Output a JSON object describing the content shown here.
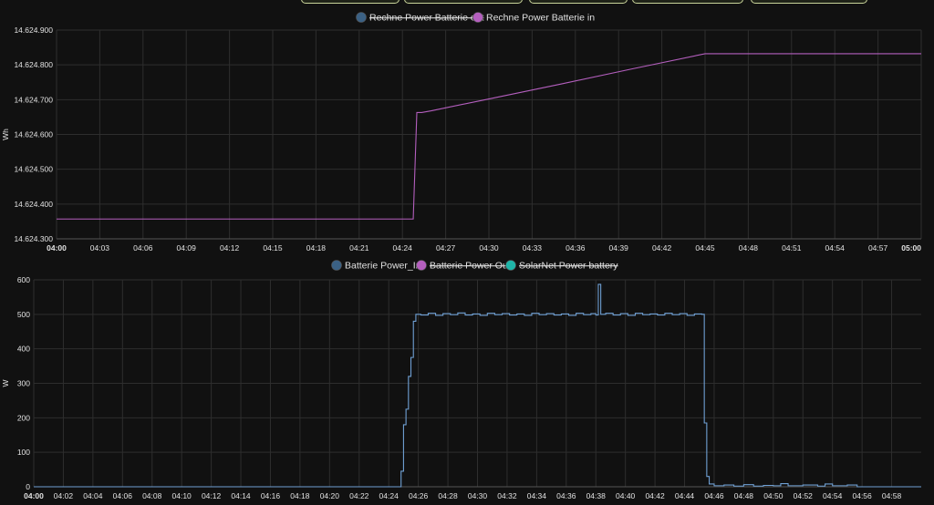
{
  "top_buttons": [
    "",
    "",
    "",
    "",
    ""
  ],
  "chart_data": [
    {
      "type": "line",
      "ylabel": "Wh",
      "ylim": [
        14624.3,
        14624.9
      ],
      "y_ticks": [
        {
          "value": 14624.9,
          "label": "14.624.900"
        },
        {
          "value": 14624.8,
          "label": "14.624.800"
        },
        {
          "value": 14624.7,
          "label": "14.624.700"
        },
        {
          "value": 14624.6,
          "label": "14.624.600"
        },
        {
          "value": 14624.5,
          "label": "14.624.500"
        },
        {
          "value": 14624.4,
          "label": "14.624.400"
        },
        {
          "value": 14624.3,
          "label": "14.624.300"
        }
      ],
      "x_range": [
        "04:00",
        "05:00"
      ],
      "x_ticks": [
        {
          "value": "04:00",
          "label": "04:00",
          "bold": true
        },
        {
          "value": "04:03",
          "label": "04:03"
        },
        {
          "value": "04:06",
          "label": "04:06"
        },
        {
          "value": "04:09",
          "label": "04:09"
        },
        {
          "value": "04:12",
          "label": "04:12"
        },
        {
          "value": "04:15",
          "label": "04:15"
        },
        {
          "value": "04:18",
          "label": "04:18"
        },
        {
          "value": "04:21",
          "label": "04:21"
        },
        {
          "value": "04:24",
          "label": "04:24"
        },
        {
          "value": "04:27",
          "label": "04:27"
        },
        {
          "value": "04:30",
          "label": "04:30"
        },
        {
          "value": "04:33",
          "label": "04:33"
        },
        {
          "value": "04:36",
          "label": "04:36"
        },
        {
          "value": "04:39",
          "label": "04:39"
        },
        {
          "value": "04:42",
          "label": "04:42"
        },
        {
          "value": "04:45",
          "label": "04:45"
        },
        {
          "value": "04:48",
          "label": "04:48"
        },
        {
          "value": "04:51",
          "label": "04:51"
        },
        {
          "value": "04:54",
          "label": "04:54"
        },
        {
          "value": "04:57",
          "label": "04:57"
        },
        {
          "value": "05:00",
          "label": "05:00",
          "bold": true
        }
      ],
      "grid": true,
      "legend_position": "top",
      "legend": [
        {
          "name": "Rechne Power Batterie out",
          "color": "#3b6184",
          "hidden": true
        },
        {
          "name": "Rechne Power Batterie in",
          "color": "#b45fbe",
          "hidden": false
        }
      ],
      "series": [
        {
          "name": "Rechne Power Batterie in",
          "color": "#b45fbe",
          "step": false,
          "points": [
            [
              "04:00",
              14624.357
            ],
            [
              "04:24:45",
              14624.357
            ],
            [
              "04:25:00",
              14624.663
            ],
            [
              "04:25:20",
              14624.663
            ],
            [
              "04:26:00",
              14624.668
            ],
            [
              "04:30:00",
              14624.702
            ],
            [
              "04:35:00",
              14624.745
            ],
            [
              "04:40:00",
              14624.789
            ],
            [
              "04:45:00",
              14624.832
            ],
            [
              "04:50:00",
              14624.832
            ],
            [
              "05:00:00",
              14624.832
            ]
          ]
        }
      ]
    },
    {
      "type": "line",
      "ylabel": "W",
      "ylim": [
        0,
        600
      ],
      "y_ticks": [
        {
          "value": 600,
          "label": "600"
        },
        {
          "value": 500,
          "label": "500"
        },
        {
          "value": 400,
          "label": "400"
        },
        {
          "value": 300,
          "label": "300"
        },
        {
          "value": 200,
          "label": "200"
        },
        {
          "value": 100,
          "label": "100"
        },
        {
          "value": 0,
          "label": "0"
        }
      ],
      "x_range": [
        "04:00",
        "05:00"
      ],
      "x_ticks": [
        {
          "value": "04:00",
          "label": "04:00",
          "bold": true
        },
        {
          "value": "04:02",
          "label": "04:02"
        },
        {
          "value": "04:04",
          "label": "04:04"
        },
        {
          "value": "04:06",
          "label": "04:06"
        },
        {
          "value": "04:08",
          "label": "04:08"
        },
        {
          "value": "04:10",
          "label": "04:10"
        },
        {
          "value": "04:12",
          "label": "04:12"
        },
        {
          "value": "04:14",
          "label": "04:14"
        },
        {
          "value": "04:16",
          "label": "04:16"
        },
        {
          "value": "04:18",
          "label": "04:18"
        },
        {
          "value": "04:20",
          "label": "04:20"
        },
        {
          "value": "04:22",
          "label": "04:22"
        },
        {
          "value": "04:24",
          "label": "04:24"
        },
        {
          "value": "04:26",
          "label": "04:26"
        },
        {
          "value": "04:28",
          "label": "04:28"
        },
        {
          "value": "04:30",
          "label": "04:30"
        },
        {
          "value": "04:32",
          "label": "04:32"
        },
        {
          "value": "04:34",
          "label": "04:34"
        },
        {
          "value": "04:36",
          "label": "04:36"
        },
        {
          "value": "04:38",
          "label": "04:38"
        },
        {
          "value": "04:40",
          "label": "04:40"
        },
        {
          "value": "04:42",
          "label": "04:42"
        },
        {
          "value": "04:44",
          "label": "04:44"
        },
        {
          "value": "04:46",
          "label": "04:46"
        },
        {
          "value": "04:48",
          "label": "04:48"
        },
        {
          "value": "04:50",
          "label": "04:50"
        },
        {
          "value": "04:52",
          "label": "04:52"
        },
        {
          "value": "04:54",
          "label": "04:54"
        },
        {
          "value": "04:56",
          "label": "04:56"
        },
        {
          "value": "04:58",
          "label": "04:58"
        }
      ],
      "grid": true,
      "legend_position": "top",
      "legend": [
        {
          "name": "Batterie Power_In",
          "color": "#3b6184",
          "hidden": false
        },
        {
          "name": "Batterie Power Out",
          "color": "#b45fbe",
          "hidden": true
        },
        {
          "name": "SolarNet Power battery",
          "color": "#1fb5a8",
          "hidden": true
        }
      ],
      "series": [
        {
          "name": "Batterie Power_In",
          "color": "#6fa0d4",
          "step": true,
          "points": [
            [
              "04:00:00",
              0
            ],
            [
              "04:24:40",
              0
            ],
            [
              "04:24:50",
              45
            ],
            [
              "04:25:00",
              180
            ],
            [
              "04:25:10",
              225
            ],
            [
              "04:25:20",
              320
            ],
            [
              "04:25:30",
              375
            ],
            [
              "04:25:40",
              480
            ],
            [
              "04:25:50",
              500
            ],
            [
              "04:26:10",
              498
            ],
            [
              "04:26:40",
              503
            ],
            [
              "04:27:10",
              497
            ],
            [
              "04:27:40",
              502
            ],
            [
              "04:28:10",
              499
            ],
            [
              "04:28:40",
              504
            ],
            [
              "04:29:10",
              498
            ],
            [
              "04:29:40",
              501
            ],
            [
              "04:30:10",
              497
            ],
            [
              "04:30:40",
              503
            ],
            [
              "04:31:10",
              499
            ],
            [
              "04:31:40",
              502
            ],
            [
              "04:32:10",
              498
            ],
            [
              "04:32:40",
              501
            ],
            [
              "04:33:10",
              497
            ],
            [
              "04:33:40",
              503
            ],
            [
              "04:34:10",
              499
            ],
            [
              "04:34:40",
              502
            ],
            [
              "04:35:10",
              498
            ],
            [
              "04:35:40",
              501
            ],
            [
              "04:36:10",
              497
            ],
            [
              "04:36:40",
              503
            ],
            [
              "04:37:10",
              499
            ],
            [
              "04:37:40",
              502
            ],
            [
              "04:38:00",
              498
            ],
            [
              "04:38:10",
              587
            ],
            [
              "04:38:20",
              500
            ],
            [
              "04:38:40",
              503
            ],
            [
              "04:39:10",
              498
            ],
            [
              "04:39:40",
              502
            ],
            [
              "04:40:10",
              497
            ],
            [
              "04:40:40",
              503
            ],
            [
              "04:41:10",
              499
            ],
            [
              "04:41:40",
              501
            ],
            [
              "04:42:10",
              498
            ],
            [
              "04:42:40",
              503
            ],
            [
              "04:43:10",
              499
            ],
            [
              "04:43:40",
              502
            ],
            [
              "04:44:10",
              497
            ],
            [
              "04:44:40",
              501
            ],
            [
              "04:45:10",
              500
            ],
            [
              "04:45:20",
              185
            ],
            [
              "04:45:30",
              30
            ],
            [
              "04:45:40",
              8
            ],
            [
              "04:46:00",
              3
            ],
            [
              "04:46:40",
              5
            ],
            [
              "04:47:20",
              2
            ],
            [
              "04:48:00",
              6
            ],
            [
              "04:48:40",
              2
            ],
            [
              "04:49:20",
              4
            ],
            [
              "04:50:00",
              3
            ],
            [
              "04:50:30",
              9
            ],
            [
              "04:51:00",
              3
            ],
            [
              "04:52:00",
              5
            ],
            [
              "04:53:00",
              2
            ],
            [
              "04:53:30",
              8
            ],
            [
              "04:54:00",
              3
            ],
            [
              "04:55:00",
              5
            ],
            [
              "04:55:40",
              0
            ],
            [
              "05:00:00",
              0
            ]
          ]
        }
      ]
    }
  ]
}
